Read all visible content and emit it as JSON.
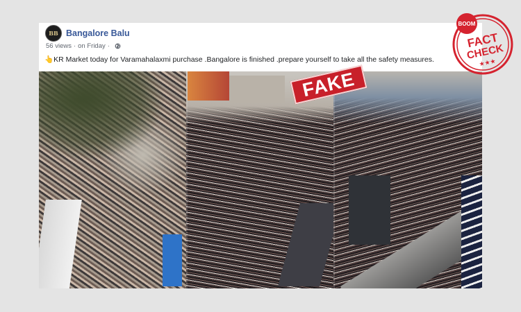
{
  "post": {
    "page_name": "Bangalore Balu",
    "avatar_initials": "BB",
    "views": "56 views",
    "separator": "·",
    "time": "on Friday",
    "separator2": "·",
    "text": "👆KR Market today for Varamahalaxmi purchase .Bangalore is finished .prepare yourself to take all the safety measures."
  },
  "overlay": {
    "stamp_text": "FAKE",
    "logo_top": "BOOM",
    "logo_line1": "FACT",
    "logo_line2": "CHECK",
    "logo_stars": "★★★"
  },
  "colors": {
    "page_name": "#385898",
    "stamp": "#c8202a",
    "logo": "#d5232f",
    "background": "#e4e4e4"
  }
}
